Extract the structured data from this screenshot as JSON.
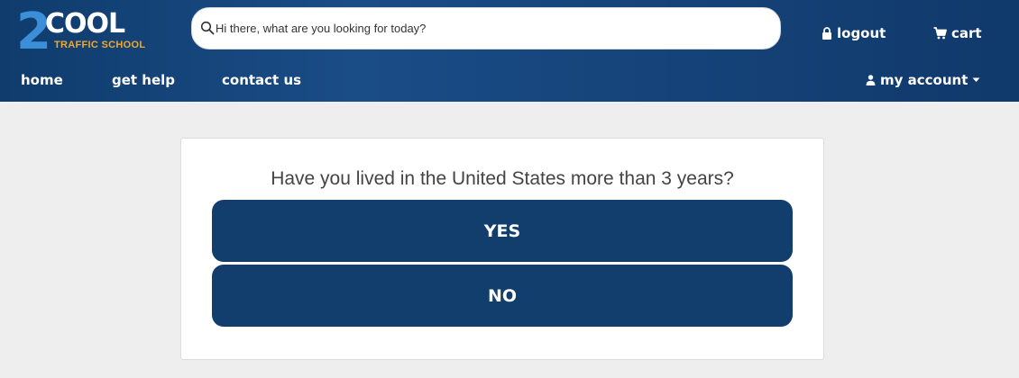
{
  "logo": {
    "primary_mark": "2",
    "primary_word": "COOL",
    "sub": "TRAFFIC SCHOOL",
    "colors": {
      "two": "#3a8fd8",
      "cool": "#ffffff",
      "sub": "#f0a830"
    }
  },
  "search": {
    "placeholder": "Hi there, what are you looking for today?",
    "icon": "search-icon"
  },
  "nav": {
    "home": "home",
    "get_help": "get help",
    "contact_us": "contact us",
    "logout": "logout",
    "cart": "cart",
    "my_account": "my account"
  },
  "icons": {
    "logout": "lock-icon",
    "cart": "cart-icon",
    "account": "user-icon",
    "dropdown": "caret-down-icon"
  },
  "colors": {
    "header": "#16467d",
    "page_bg": "#eeeeee",
    "button": "#123e6e"
  },
  "question": {
    "text": "Have you lived in the United States more than 3 years?",
    "yes_label": "YES",
    "no_label": "NO"
  }
}
